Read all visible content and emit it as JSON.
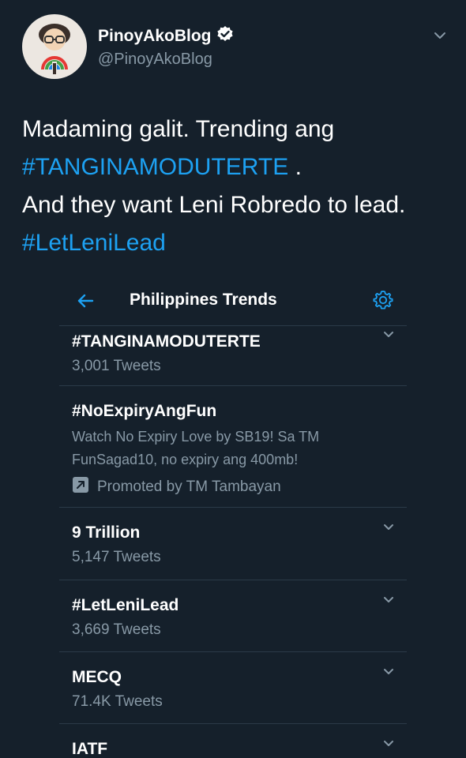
{
  "tweet": {
    "author_name": "PinoyAkoBlog",
    "author_handle": "@PinoyAkoBlog",
    "verified": true,
    "text_line1": "Madaming galit. Trending ang",
    "hashtag1": "#TANGINAMODUTERTE",
    "text_after_hashtag1": " .",
    "text_line3": "And they want Leni Robredo to lead.",
    "hashtag2": "#LetLeniLead"
  },
  "trends_card": {
    "title": "Philippines Trends",
    "back_icon": "arrow-left-icon",
    "settings_icon": "gear-icon",
    "trends": [
      {
        "name": "#TANGINAMODUTERTE",
        "count": "3,001 Tweets"
      },
      {
        "name": "#NoExpiryAngFun",
        "description": "Watch No Expiry Love by SB19! Sa TM FunSagad10, no expiry ang 400mb!",
        "promoted": "Promoted by TM Tambayan"
      },
      {
        "name": "9 Trillion",
        "count": "5,147 Tweets"
      },
      {
        "name": "#LetLeniLead",
        "count": "3,669 Tweets"
      },
      {
        "name": "MECQ",
        "count": "71.4K Tweets"
      },
      {
        "name": "IATF"
      }
    ]
  },
  "colors": {
    "background": "#15202b",
    "accent": "#1da1f2",
    "secondary_text": "#8899a6",
    "divider": "#2b3a48"
  }
}
